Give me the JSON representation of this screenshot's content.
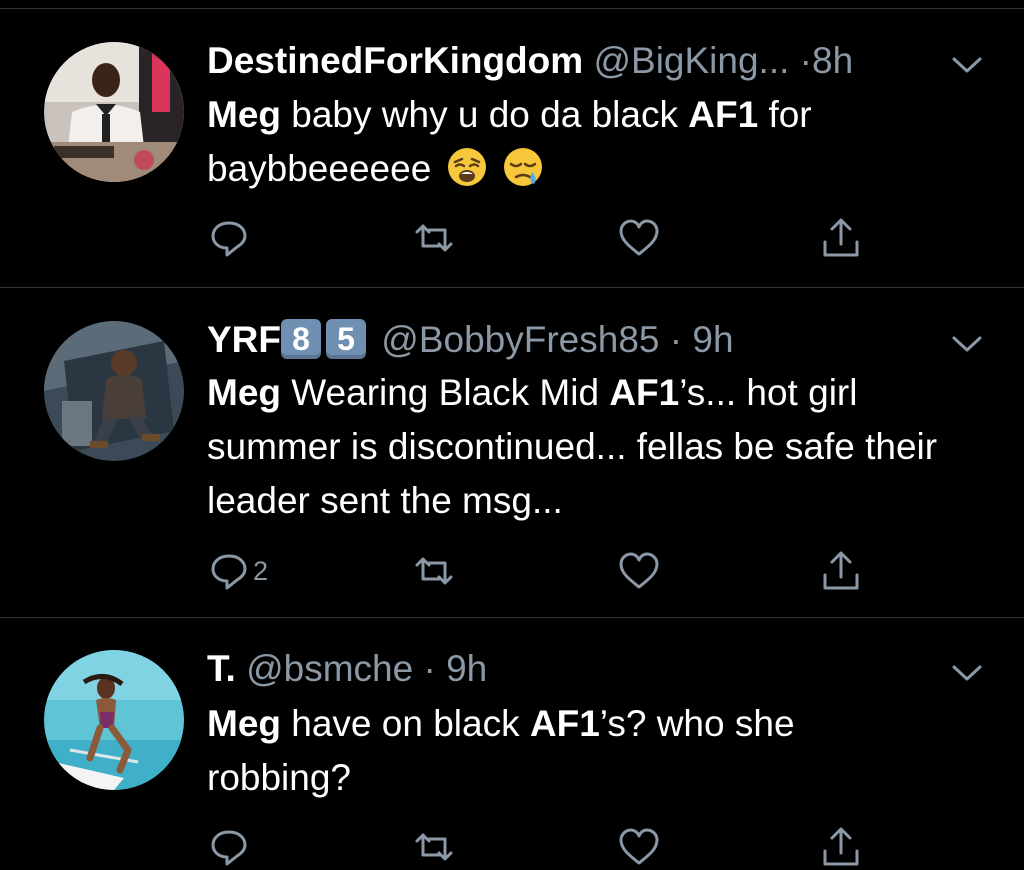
{
  "tweets": [
    {
      "name": "DestinedForKingdom",
      "handle": "@BigKing...",
      "time": "8h",
      "badges": [],
      "body_pre": "",
      "body_b1": "Meg",
      "body_mid": " baby why u do da black ",
      "body_b2": "AF1",
      "body_post": " for baybbeeeeee",
      "reply_count": "",
      "emojis": [
        "weary-face",
        "sleepy-face"
      ]
    },
    {
      "name": "YRF",
      "badges": [
        "8",
        "5"
      ],
      "handle": "@BobbyFresh85",
      "time": "9h",
      "body_b1": "Meg",
      "body_mid": " Wearing Black Mid ",
      "body_b2": "AF1",
      "body_post": "’s... hot girl summer is discontinued... fellas be safe their leader sent the msg...",
      "reply_count": "2"
    },
    {
      "name": "T.",
      "badges": [],
      "handle": "@bsmche",
      "time": "9h",
      "body_b1": "Meg",
      "body_mid": " have on black ",
      "body_b2": "AF1",
      "body_post": "’s? who she robbing?",
      "reply_count": ""
    }
  ],
  "separator": "·",
  "icons": {
    "reply": "reply-icon",
    "retweet": "retweet-icon",
    "like": "heart-icon",
    "share": "share-icon",
    "menu": "chevron-down-icon"
  },
  "colors": {
    "background": "#000000",
    "secondary_text": "#8b98a5",
    "divider": "#2f3336",
    "badge": "#6f8fb3"
  }
}
